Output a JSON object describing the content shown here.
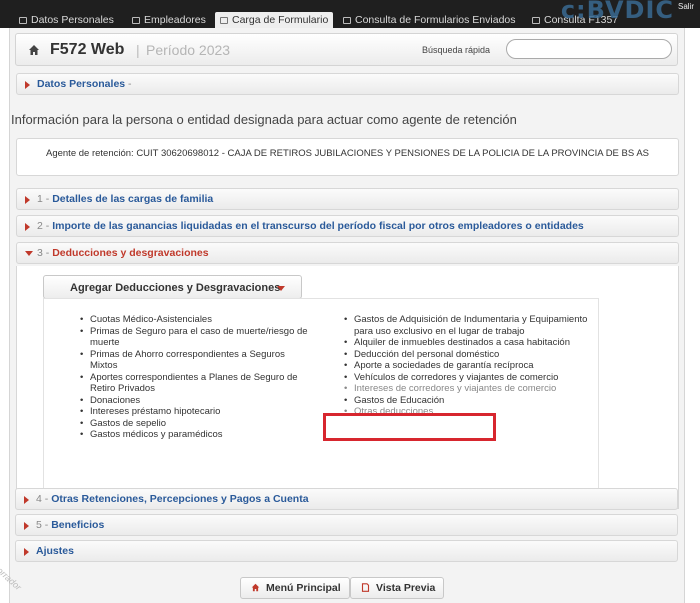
{
  "nav": {
    "tabs": [
      {
        "label": "Datos Personales"
      },
      {
        "label": "Empleadores"
      },
      {
        "label": "Carga de Formulario"
      },
      {
        "label": "Consulta de Formularios Enviados"
      },
      {
        "label": "Consulta F1357"
      }
    ],
    "brand": "c:BVDIC",
    "exit_label": "Salir"
  },
  "header": {
    "title": "F572 Web",
    "separator": "|",
    "period": "Período 2023",
    "search_label": "Búsqueda rápida",
    "search_value": ""
  },
  "datos_personales": {
    "title": "Datos Personales",
    "dash": "-"
  },
  "info_text": "Información para la persona o entidad designada para actuar como agente de retención",
  "agent": "Agente de retención: CUIT 30620698012 - CAJA DE RETIROS JUBILACIONES Y PENSIONES DE LA POLICIA DE LA PROVINCIA DE BS AS",
  "sections": {
    "s1": {
      "num": "1 -",
      "title": "Detalles de las cargas de familia"
    },
    "s2": {
      "num": "2 -",
      "title": "Importe de las ganancias liquidadas en el transcurso del período fiscal por otros empleadores o entidades"
    },
    "s3": {
      "num": "3 -",
      "title": "Deducciones y desgravaciones"
    },
    "s4": {
      "num": "4 -",
      "title": "Otras Retenciones, Percepciones y Pagos a Cuenta"
    },
    "s5": {
      "num": "5 -",
      "title": "Beneficios"
    },
    "s6": {
      "title": "Ajustes"
    }
  },
  "deductions": {
    "dropdown_label": "Agregar Deducciones y Desgravaciones",
    "col1": [
      "Cuotas Médico-Asistenciales",
      "Primas de Seguro para el caso de muerte/riesgo de muerte",
      "Primas de Ahorro correspondientes a Seguros Mixtos",
      "Aportes correspondientes a Planes de Seguro de Retiro Privados",
      "Donaciones",
      "Intereses préstamo hipotecario",
      "Gastos de sepelio",
      "Gastos médicos y paramédicos"
    ],
    "col2": [
      "Gastos de Adquisición de Indumentaria y Equipamiento para uso exclusivo en el lugar de trabajo",
      "Alquiler de inmuebles destinados a casa habitación",
      "Deducción del personal doméstico",
      "Aporte a sociedades de garantía recíproca",
      "Vehículos de corredores y viajantes de comercio",
      "Intereses de corredores y viajantes de comercio",
      "Gastos de Educación",
      "Otras deducciones"
    ]
  },
  "buttons": {
    "menu": "Menú Principal",
    "preview": "Vista Previa"
  },
  "draft_label": "borrador",
  "colors": {
    "accent": "#c0392b",
    "link": "#2a5a9a",
    "highlight": "#d7262e"
  }
}
